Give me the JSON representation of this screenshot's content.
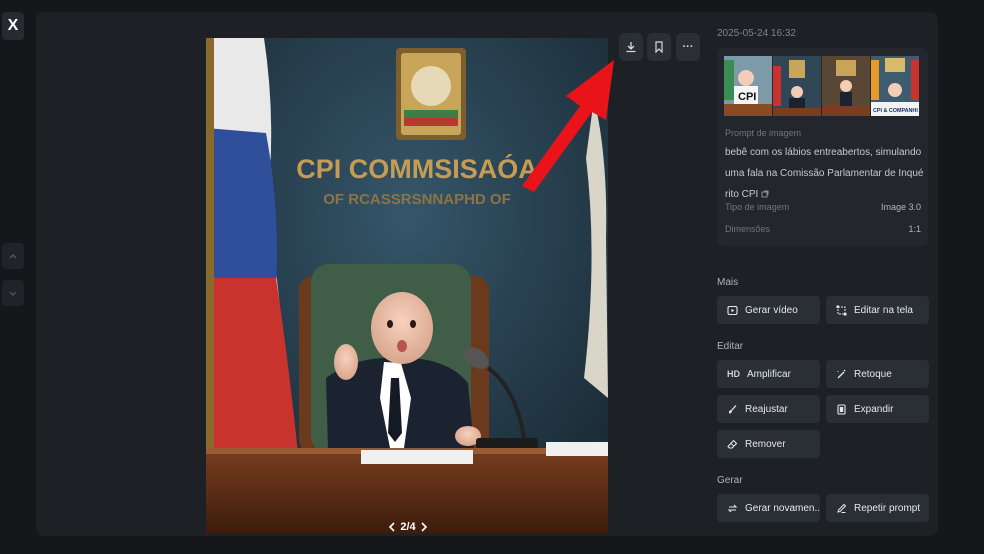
{
  "close_label": "X",
  "image": {
    "pager": {
      "prev_icon": "chevron-left-icon",
      "counter": "2/4",
      "next_icon": "chevron-right-icon"
    },
    "scene_text": {
      "emblem_line1": "CPI COMMSISAÓA",
      "emblem_line2": "OF RCASSRSNNAPHD OF"
    }
  },
  "toolbar": {
    "download_icon": "download-icon",
    "bookmark_icon": "bookmark-icon",
    "more_label": "···"
  },
  "details": {
    "timestamp": "2025-05-24 16:32",
    "thumb_captions": [
      "CPI",
      "CPI & COMPANHI"
    ],
    "prompt_label": "Prompt de imagem",
    "prompt_text": "bebê com os lábios entreabertos, simulando uma fala na Comissão Parlamentar de Inquérito CPI",
    "meta": [
      {
        "label": "Tipo de imagem",
        "value": "Image 3.0"
      },
      {
        "label": "Dimensões",
        "value": "1:1"
      }
    ]
  },
  "sections": {
    "mais": {
      "title": "Mais",
      "buttons": [
        "Gerar vídeo",
        "Editar na tela"
      ]
    },
    "editar": {
      "title": "Editar",
      "hd_badge": "HD",
      "buttons": [
        "Amplificar",
        "Retoque",
        "Reajustar",
        "Expandir",
        "Remover"
      ]
    },
    "gerar": {
      "title": "Gerar",
      "buttons": [
        "Gerar novamen...",
        "Repetir prompt"
      ]
    }
  },
  "colors": {
    "arrow": "#e8141a",
    "panel": "#1d2025",
    "button": "#2a2e35",
    "flag_red": "#c9332e",
    "flag_blue": "#2f4f9b"
  }
}
